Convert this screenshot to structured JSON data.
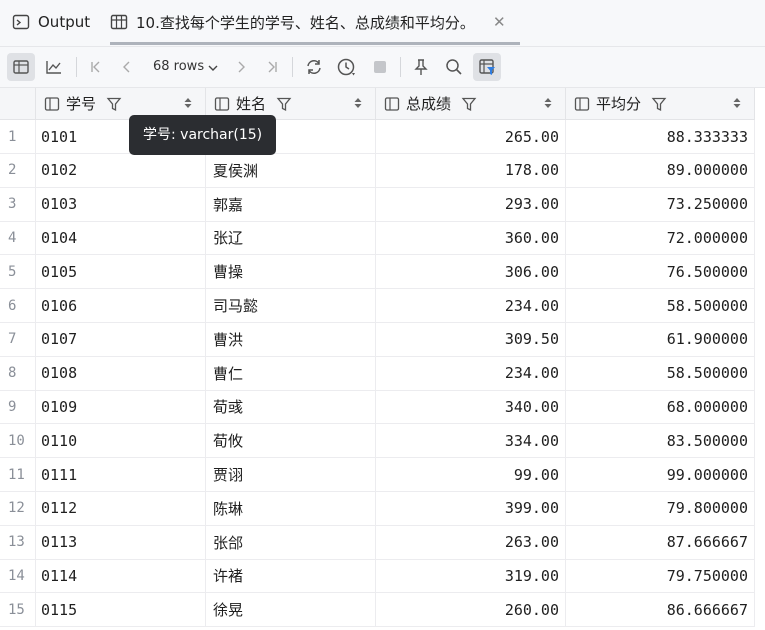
{
  "tabs": [
    {
      "label": "Output",
      "icon": "terminal-icon"
    },
    {
      "label": "10.查找每个学生的学号、姓名、总成绩和平均分。",
      "icon": "table-icon"
    }
  ],
  "toolbar": {
    "rows_label": "68 rows"
  },
  "columns": [
    "学号",
    "姓名",
    "总成绩",
    "平均分"
  ],
  "tooltip": "学号: varchar(15)",
  "rows": [
    {
      "n": "1",
      "id": "0101",
      "name": "",
      "total": "265.00",
      "avg": "88.333333"
    },
    {
      "n": "2",
      "id": "0102",
      "name": "夏侯渊",
      "total": "178.00",
      "avg": "89.000000"
    },
    {
      "n": "3",
      "id": "0103",
      "name": "郭嘉",
      "total": "293.00",
      "avg": "73.250000"
    },
    {
      "n": "4",
      "id": "0104",
      "name": "张辽",
      "total": "360.00",
      "avg": "72.000000"
    },
    {
      "n": "5",
      "id": "0105",
      "name": "曹操",
      "total": "306.00",
      "avg": "76.500000"
    },
    {
      "n": "6",
      "id": "0106",
      "name": "司马懿",
      "total": "234.00",
      "avg": "58.500000"
    },
    {
      "n": "7",
      "id": "0107",
      "name": "曹洪",
      "total": "309.50",
      "avg": "61.900000"
    },
    {
      "n": "8",
      "id": "0108",
      "name": "曹仁",
      "total": "234.00",
      "avg": "58.500000"
    },
    {
      "n": "9",
      "id": "0109",
      "name": "荀彧",
      "total": "340.00",
      "avg": "68.000000"
    },
    {
      "n": "10",
      "id": "0110",
      "name": "荀攸",
      "total": "334.00",
      "avg": "83.500000"
    },
    {
      "n": "11",
      "id": "0111",
      "name": "贾诩",
      "total": "99.00",
      "avg": "99.000000"
    },
    {
      "n": "12",
      "id": "0112",
      "name": "陈琳",
      "total": "399.00",
      "avg": "79.800000"
    },
    {
      "n": "13",
      "id": "0113",
      "name": "张郃",
      "total": "263.00",
      "avg": "87.666667"
    },
    {
      "n": "14",
      "id": "0114",
      "name": "许褚",
      "total": "319.00",
      "avg": "79.750000"
    },
    {
      "n": "15",
      "id": "0115",
      "name": "徐晃",
      "total": "260.00",
      "avg": "86.666667"
    }
  ]
}
